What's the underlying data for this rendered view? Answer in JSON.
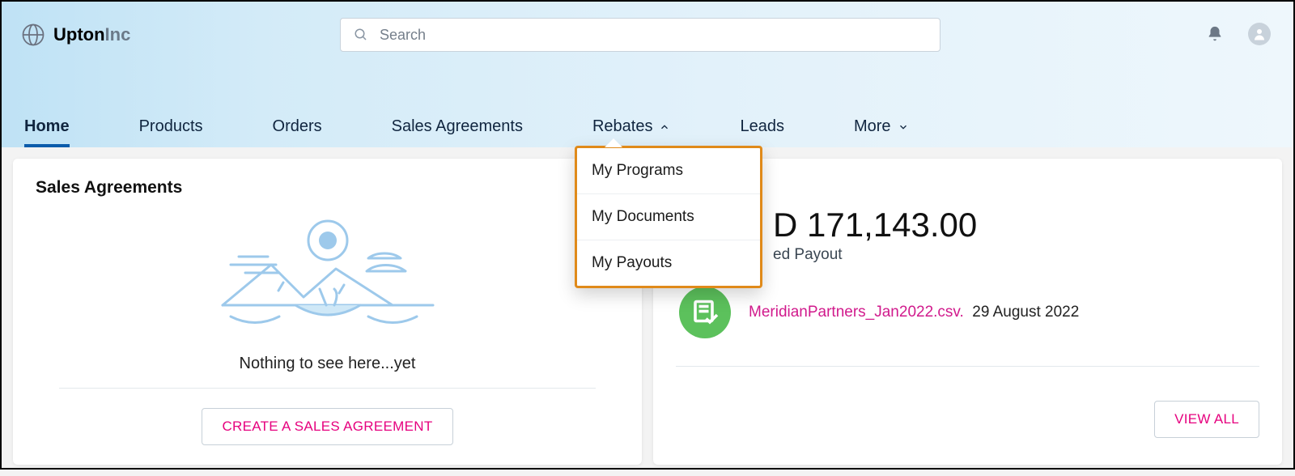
{
  "brand": {
    "name1": "Upton",
    "name2": "Inc"
  },
  "search": {
    "placeholder": "Search"
  },
  "nav": {
    "items": [
      {
        "label": "Home",
        "active": true
      },
      {
        "label": "Products"
      },
      {
        "label": "Orders"
      },
      {
        "label": "Sales Agreements"
      },
      {
        "label": "Rebates",
        "expanded": true
      },
      {
        "label": "Leads"
      },
      {
        "label": "More",
        "hasChevronDown": true
      }
    ],
    "rebatesMenu": [
      "My Programs",
      "My Documents",
      "My Payouts"
    ]
  },
  "salesAgreements": {
    "title": "Sales Agreements",
    "empty": "Nothing to see here...yet",
    "cta": "CREATE A SALES AGREEMENT"
  },
  "payout": {
    "amount_prefix_partial": "D",
    "amount": "171,143.00",
    "label_partial": "ed Payout",
    "file": "MeridianPartners_Jan2022.csv.",
    "date": "29 August 2022",
    "viewAll": "VIEW ALL"
  }
}
